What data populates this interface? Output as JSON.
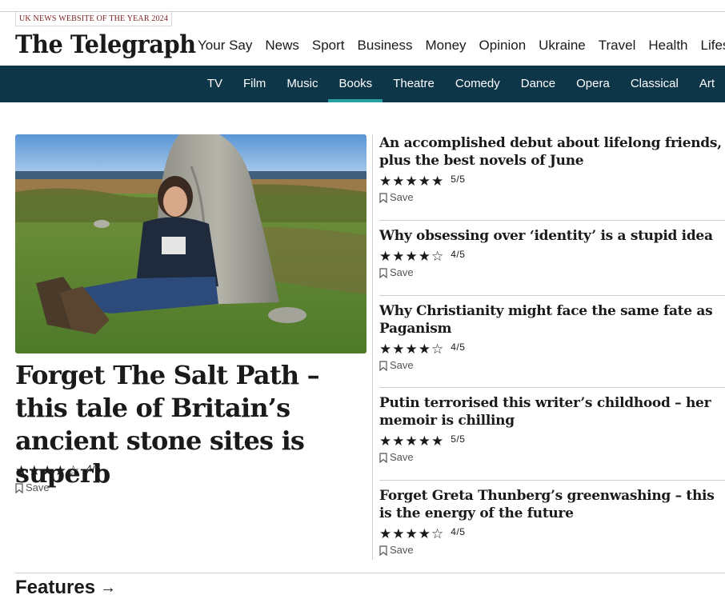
{
  "masthead": {
    "award": "UK NEWS WEBSITE OF THE YEAR 2024",
    "logo_text": "The Telegraph"
  },
  "main_nav": [
    "Your Say",
    "News",
    "Sport",
    "Business",
    "Money",
    "Opinion",
    "Ukraine",
    "Travel",
    "Health",
    "Lifesty"
  ],
  "sub_nav": {
    "items": [
      "TV",
      "Film",
      "Music",
      "Books",
      "Theatre",
      "Comedy",
      "Dance",
      "Opera",
      "Classical",
      "Art"
    ],
    "active": "Books",
    "background": "#0e3649",
    "active_underline": "#2aa1a1"
  },
  "lead_story": {
    "headline": "Forget The Salt Path – this tale of Britain’s ancient stone sites is superb",
    "stars": "★★★★☆",
    "rating": 4,
    "rating_text": "4/5",
    "save_label": "Save"
  },
  "stories": [
    {
      "headline": "An accomplished debut about lifelong friends, plus the best novels of June",
      "stars": "★★★★★",
      "rating": 5,
      "rating_text": "5/5",
      "save_label": "Save"
    },
    {
      "headline": "Why obsessing over ‘identity’ is a stupid idea",
      "stars": "★★★★☆",
      "rating": 4,
      "rating_text": "4/5",
      "save_label": "Save"
    },
    {
      "headline": "Why Christianity might face the same fate as Paganism",
      "stars": "★★★★☆",
      "rating": 4,
      "rating_text": "4/5",
      "save_label": "Save"
    },
    {
      "headline": "Putin terrorised this writer’s childhood – her memoir is chilling",
      "stars": "★★★★★",
      "rating": 5,
      "rating_text": "5/5",
      "save_label": "Save"
    },
    {
      "headline": "Forget Greta Thunberg’s greenwashing – this is the energy of the future",
      "stars": "★★★★☆",
      "rating": 4,
      "rating_text": "4/5",
      "save_label": "Save"
    }
  ],
  "section": {
    "title": "Features",
    "arrow_icon": "arrow-right-icon"
  }
}
